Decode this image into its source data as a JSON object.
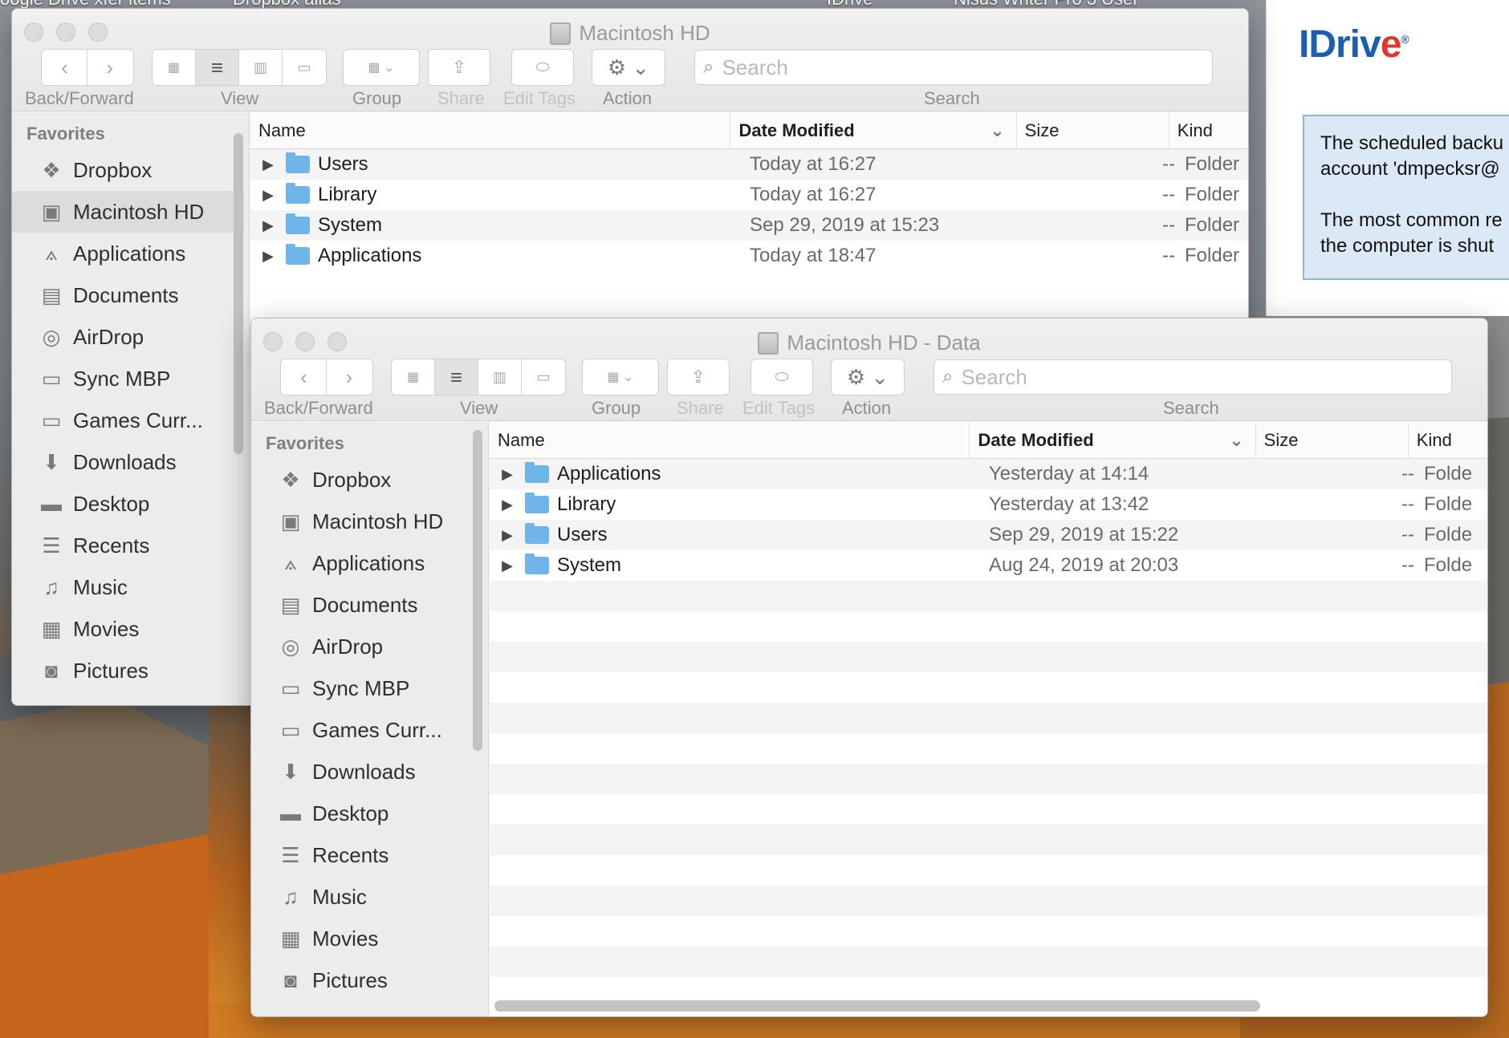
{
  "desktop": {
    "labels": [
      "oogle Drive xfer items",
      "Dropbox alias",
      "IDrive",
      "Nisus Writer Pro 3 User"
    ]
  },
  "idrive": {
    "logo": "IDrive",
    "message_line1": "The scheduled backu",
    "message_line2": "account 'dmpecksr@",
    "message_line3": "The most common re",
    "message_line4": "the computer is shut"
  },
  "back_window": {
    "title": "Macintosh HD",
    "toolbar": {
      "back_forward_label": "Back/Forward",
      "view_label": "View",
      "group_label": "Group",
      "share_label": "Share",
      "edit_tags_label": "Edit Tags",
      "action_label": "Action",
      "search_label": "Search",
      "search_placeholder": "Search"
    },
    "sidebar": {
      "heading": "Favorites",
      "items": [
        {
          "label": "Dropbox",
          "icon": "dropbox-icon"
        },
        {
          "label": "Macintosh HD",
          "icon": "hard-drive-icon"
        },
        {
          "label": "Applications",
          "icon": "applications-icon"
        },
        {
          "label": "Documents",
          "icon": "documents-icon"
        },
        {
          "label": "AirDrop",
          "icon": "airdrop-icon"
        },
        {
          "label": "Sync MBP",
          "icon": "folder-icon"
        },
        {
          "label": "Games Curr...",
          "icon": "folder-icon"
        },
        {
          "label": "Downloads",
          "icon": "downloads-icon"
        },
        {
          "label": "Desktop",
          "icon": "desktop-icon"
        },
        {
          "label": "Recents",
          "icon": "recents-icon"
        },
        {
          "label": "Music",
          "icon": "music-icon"
        },
        {
          "label": "Movies",
          "icon": "movies-icon"
        },
        {
          "label": "Pictures",
          "icon": "pictures-icon"
        }
      ]
    },
    "columns": {
      "name": "Name",
      "date": "Date Modified",
      "size": "Size",
      "kind": "Kind"
    },
    "rows": [
      {
        "name": "Users",
        "date": "Today at 16:27",
        "size": "--",
        "kind": "Folder"
      },
      {
        "name": "Library",
        "date": "Today at 16:27",
        "size": "--",
        "kind": "Folder"
      },
      {
        "name": "System",
        "date": "Sep 29, 2019 at 15:23",
        "size": "--",
        "kind": "Folder"
      },
      {
        "name": "Applications",
        "date": "Today at 18:47",
        "size": "--",
        "kind": "Folder"
      }
    ]
  },
  "front_window": {
    "title": "Macintosh HD - Data",
    "toolbar": {
      "back_forward_label": "Back/Forward",
      "view_label": "View",
      "group_label": "Group",
      "share_label": "Share",
      "edit_tags_label": "Edit Tags",
      "action_label": "Action",
      "search_label": "Search",
      "search_placeholder": "Search"
    },
    "sidebar": {
      "heading": "Favorites",
      "items": [
        {
          "label": "Dropbox",
          "icon": "dropbox-icon"
        },
        {
          "label": "Macintosh HD",
          "icon": "hard-drive-icon"
        },
        {
          "label": "Applications",
          "icon": "applications-icon"
        },
        {
          "label": "Documents",
          "icon": "documents-icon"
        },
        {
          "label": "AirDrop",
          "icon": "airdrop-icon"
        },
        {
          "label": "Sync MBP",
          "icon": "folder-icon"
        },
        {
          "label": "Games Curr...",
          "icon": "folder-icon"
        },
        {
          "label": "Downloads",
          "icon": "downloads-icon"
        },
        {
          "label": "Desktop",
          "icon": "desktop-icon"
        },
        {
          "label": "Recents",
          "icon": "recents-icon"
        },
        {
          "label": "Music",
          "icon": "music-icon"
        },
        {
          "label": "Movies",
          "icon": "movies-icon"
        },
        {
          "label": "Pictures",
          "icon": "pictures-icon"
        }
      ]
    },
    "columns": {
      "name": "Name",
      "date": "Date Modified",
      "size": "Size",
      "kind": "Kind"
    },
    "rows": [
      {
        "name": "Applications",
        "date": "Yesterday at 14:14",
        "size": "--",
        "kind": "Folde"
      },
      {
        "name": "Library",
        "date": "Yesterday at 13:42",
        "size": "--",
        "kind": "Folde"
      },
      {
        "name": "Users",
        "date": "Sep 29, 2019 at 15:22",
        "size": "--",
        "kind": "Folde"
      },
      {
        "name": "System",
        "date": "Aug 24, 2019 at 20:03",
        "size": "--",
        "kind": "Folde"
      }
    ]
  },
  "colors": {
    "folder": "#6fb5ea",
    "selection": "#dcdcdc",
    "idrive_blue": "#1b5fb3",
    "idrive_red": "#e2352c"
  }
}
